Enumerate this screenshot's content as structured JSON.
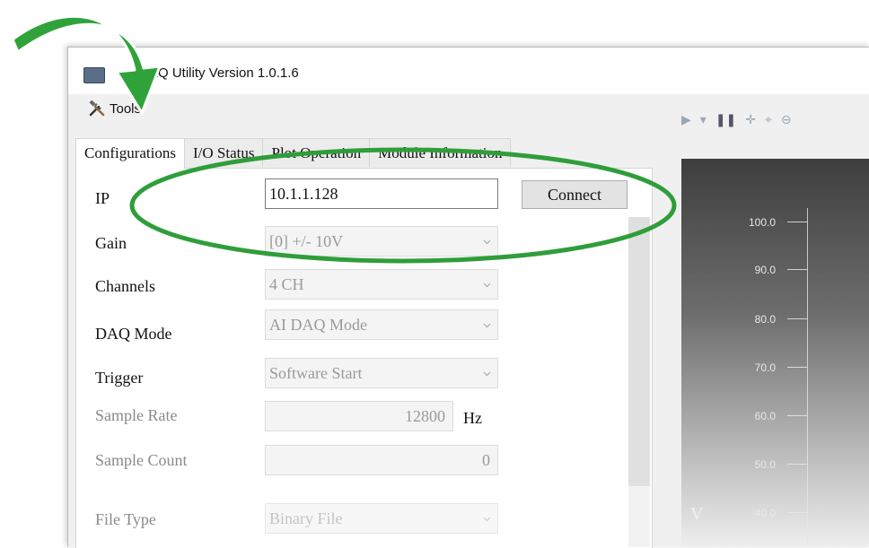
{
  "window": {
    "title": "AQ Utility Version 1.0.1.6"
  },
  "menu": {
    "tools_label": "Tools"
  },
  "tabs": [
    {
      "label": "Configurations",
      "active": true
    },
    {
      "label": "I/O Status",
      "active": false
    },
    {
      "label": "Plot Operation",
      "active": false
    },
    {
      "label": "Module Information",
      "active": false
    }
  ],
  "config": {
    "ip": {
      "label": "IP",
      "value": "10.1.1.128"
    },
    "connect_label": "Connect",
    "gain": {
      "label": "Gain",
      "value": "[0] +/- 10V"
    },
    "channels": {
      "label": "Channels",
      "value": "4 CH"
    },
    "daq_mode": {
      "label": "DAQ Mode",
      "value": "AI DAQ Mode"
    },
    "trigger": {
      "label": "Trigger",
      "value": "Software Start"
    },
    "sample_rate": {
      "label": "Sample Rate",
      "value": "12800",
      "unit": "Hz"
    },
    "sample_count": {
      "label": "Sample Count",
      "value": "0"
    },
    "file_type": {
      "label": "File Type",
      "value": "Binary File"
    }
  },
  "plot": {
    "y_axis_letter": "V",
    "y_ticks": [
      "100.0",
      "90.0",
      "80.0",
      "70.0",
      "60.0",
      "50.0",
      "40.0"
    ]
  },
  "colors": {
    "highlight_green": "#2f9e3a",
    "arrow_green": "#2fa33a"
  }
}
